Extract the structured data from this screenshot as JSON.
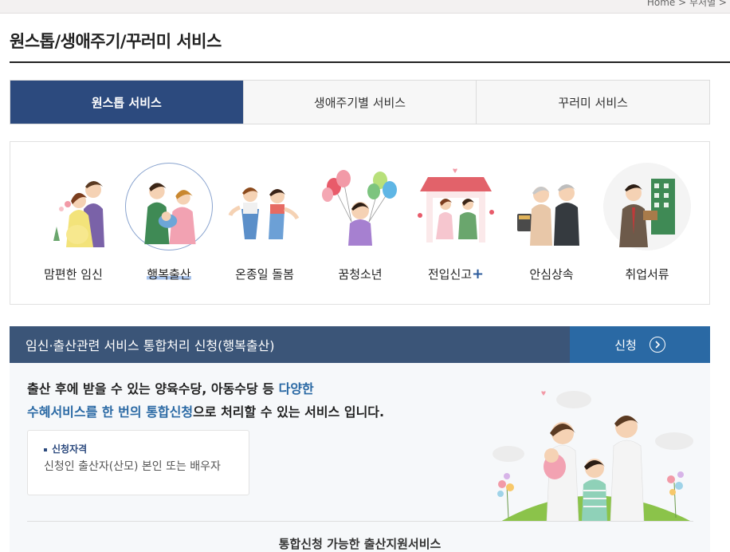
{
  "breadcrumb": "Home  >  부처별  >",
  "page_title": "원스톱/생애주기/꾸러미 서비스",
  "tabs": [
    {
      "label": "원스톱 서비스",
      "active": true
    },
    {
      "label": "생애주기별 서비스",
      "active": false
    },
    {
      "label": "꾸러미 서비스",
      "active": false
    }
  ],
  "services": [
    {
      "label": "맘편한 임신",
      "icon": "pregnancy-couple-icon"
    },
    {
      "label": "행복출산",
      "icon": "family-baby-icon"
    },
    {
      "label": "온종일 돌봄",
      "icon": "children-care-icon"
    },
    {
      "label": "꿈청소년",
      "icon": "youth-balloons-icon"
    },
    {
      "label": "전입신고",
      "plus": "+",
      "icon": "house-move-icon"
    },
    {
      "label": "안심상속",
      "icon": "elderly-couple-icon"
    },
    {
      "label": "취업서류",
      "icon": "job-documents-icon"
    }
  ],
  "service_bar": {
    "title": "임신·출산관련 서비스 통합처리 신청(행복출산)",
    "apply_label": "신청"
  },
  "description": {
    "part1": "출산 후에 받을 수 있는 양육수당, 아동수당 등 ",
    "highlight1": "다양한",
    "highlight2": "수혜서비스를 한 번의 통합신청",
    "part2": "으로 처리할 수 있는 서비스 입니다."
  },
  "qualification": {
    "heading": "신청자격",
    "text": "신청인 출산자(산모) 본인 또는 배우자"
  },
  "available_services_title": "통합신청 가능한 출산지원서비스",
  "colors": {
    "accent": "#2c4a7e",
    "service_bar": "#3b5578",
    "apply_button": "#2a69a4"
  }
}
